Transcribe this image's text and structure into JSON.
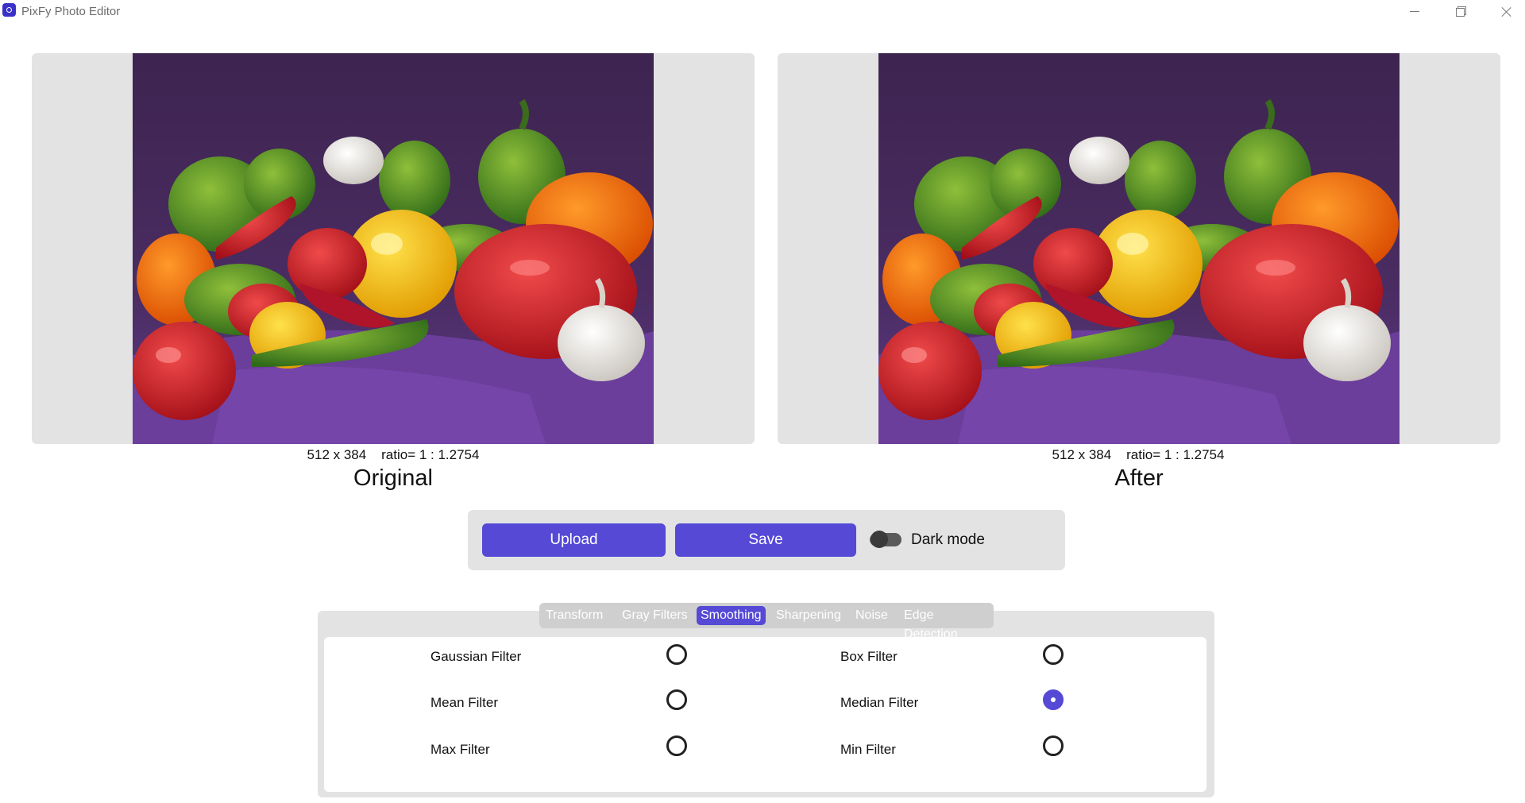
{
  "window": {
    "title": "PixFy Photo Editor"
  },
  "images": {
    "original": {
      "dimensions": "512 x 384",
      "ratio": "ratio= 1 : 1.2754",
      "caption": "Original"
    },
    "after": {
      "dimensions": "512 x 384",
      "ratio": "ratio= 1 : 1.2754",
      "caption": "After"
    }
  },
  "controls": {
    "upload_label": "Upload",
    "save_label": "Save",
    "dark_mode_label": "Dark mode",
    "dark_mode_on": false
  },
  "tabs": [
    {
      "label": "Transform",
      "active": false
    },
    {
      "label": "Gray Filters",
      "active": false
    },
    {
      "label": "Smoothing",
      "active": true
    },
    {
      "label": "Sharpening",
      "active": false
    },
    {
      "label": "Noise",
      "active": false
    },
    {
      "label": "Edge Detection",
      "active": false
    }
  ],
  "filters": [
    {
      "label": "Gaussian Filter",
      "selected": false
    },
    {
      "label": "Box Filter",
      "selected": false
    },
    {
      "label": "Mean Filter",
      "selected": false
    },
    {
      "label": "Median Filter",
      "selected": true
    },
    {
      "label": "Max Filter",
      "selected": false
    },
    {
      "label": "Min Filter",
      "selected": false
    }
  ],
  "colors": {
    "accent": "#5549d6",
    "panel_bg": "#e3e3e3"
  }
}
